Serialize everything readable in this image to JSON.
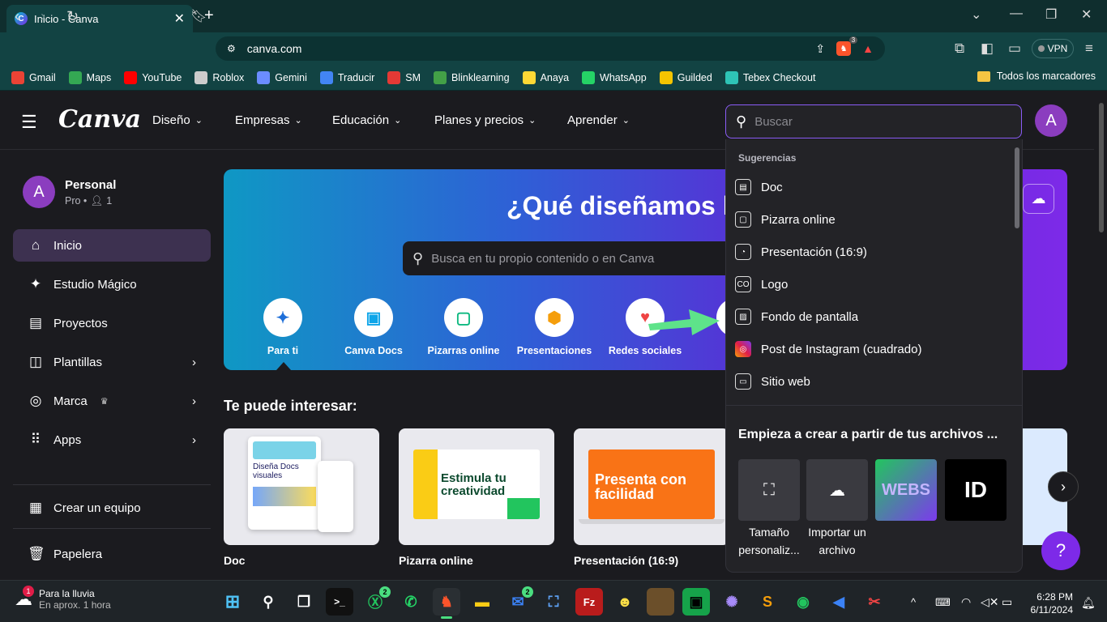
{
  "browser": {
    "tab_title": "Inicio - Canva",
    "url": "canva.com",
    "vpn_label": "VPN",
    "brave_badge": "3",
    "bookmarks": [
      {
        "label": "Gmail",
        "icon": "gmail-icon",
        "color": "#ea4335"
      },
      {
        "label": "Maps",
        "icon": "maps-icon",
        "color": "#34a853"
      },
      {
        "label": "YouTube",
        "icon": "youtube-icon",
        "color": "#ff0000"
      },
      {
        "label": "Roblox",
        "icon": "roblox-icon",
        "color": "#cccccc"
      },
      {
        "label": "Gemini",
        "icon": "gemini-icon",
        "color": "#6b8cff"
      },
      {
        "label": "Traducir",
        "icon": "translate-icon",
        "color": "#4285f4"
      },
      {
        "label": "SM",
        "icon": "sm-icon",
        "color": "#e53935"
      },
      {
        "label": "Blinklearning",
        "icon": "blinklearning-icon",
        "color": "#43a047"
      },
      {
        "label": "Anaya",
        "icon": "anaya-icon",
        "color": "#fdd835"
      },
      {
        "label": "WhatsApp",
        "icon": "whatsapp-icon",
        "color": "#25d366"
      },
      {
        "label": "Guilded",
        "icon": "guilded-icon",
        "color": "#f5c400"
      },
      {
        "label": "Tebex Checkout",
        "icon": "tebex-icon",
        "color": "#2ec4b6"
      }
    ],
    "all_bookmarks_label": "Todos los marcadores"
  },
  "header": {
    "logo": "Canva",
    "nav": [
      "Diseño",
      "Empresas",
      "Educación",
      "Planes y precios",
      "Aprender"
    ],
    "search_placeholder": "Buscar",
    "avatar_letter": "A"
  },
  "sidebar": {
    "account_name": "Personal",
    "account_plan": "Pro •",
    "member_count": "1",
    "avatar_letter": "A",
    "items": [
      {
        "label": "Inicio",
        "icon": "home-icon",
        "active": true
      },
      {
        "label": "Estudio Mágico",
        "icon": "magic-icon"
      },
      {
        "label": "Proyectos",
        "icon": "folder-icon"
      },
      {
        "label": "Plantillas",
        "icon": "templates-icon",
        "arrow": true
      },
      {
        "label": "Marca",
        "icon": "brand-icon",
        "arrow": true
      },
      {
        "label": "Apps",
        "icon": "apps-icon",
        "arrow": true
      }
    ],
    "create_team": "Crear un equipo",
    "trash": "Papelera"
  },
  "hero": {
    "title": "¿Qué diseñamos h",
    "search_placeholder": "Busca en tu propio contenido o en Canva",
    "categories": [
      "Para ti",
      "Canva Docs",
      "Pizarras online",
      "Presentaciones",
      "Redes sociales",
      "V"
    ]
  },
  "section": {
    "title": "Te puede interesar:",
    "cards": [
      {
        "label": "Doc",
        "text": "Diseña Docs visuales"
      },
      {
        "label": "Pizarra online",
        "text": "Estimula tu creatividad"
      },
      {
        "label": "Presentación (16:9)",
        "text": "Presenta con facilidad"
      }
    ]
  },
  "dropdown": {
    "suggestions_title": "Sugerencias",
    "suggestions": [
      {
        "label": "Doc",
        "icon": "doc-icon"
      },
      {
        "label": "Pizarra online",
        "icon": "whiteboard-icon"
      },
      {
        "label": "Presentación (16:9)",
        "icon": "presentation-icon"
      },
      {
        "label": "Logo",
        "icon": "logo-icon"
      },
      {
        "label": "Fondo de pantalla",
        "icon": "image-icon"
      },
      {
        "label": "Post de Instagram (cuadrado)",
        "icon": "instagram-icon"
      },
      {
        "label": "Sitio web",
        "icon": "website-icon"
      }
    ],
    "from_files_title": "Empieza a crear a partir de tus archivos ...",
    "tiles": [
      {
        "label": "Tamaño personaliz..."
      },
      {
        "label": "Importar un archivo"
      }
    ],
    "file_thumb_text": "WEBS",
    "id_thumb_text": "ID"
  },
  "taskbar": {
    "weather_title": "Para la lluvia",
    "weather_sub": "En aprox. 1 hora",
    "weather_badge": "1",
    "time": "6:28 PM",
    "date": "6/11/2024",
    "xbox_badge": "2",
    "mail_badge": "2"
  },
  "help_label": "?"
}
